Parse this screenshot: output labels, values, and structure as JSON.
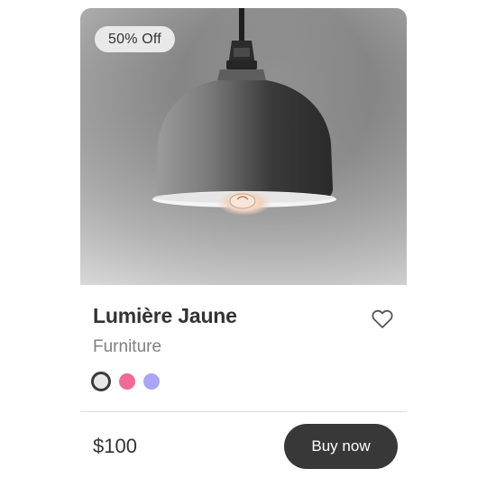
{
  "product": {
    "discount_badge": "50% Off",
    "title": "Lumière Jaune",
    "category": "Furniture",
    "price": "$100",
    "buy_label": "Buy now",
    "image_icon": "pendant-lamp",
    "favorite_icon": "heart-icon",
    "swatches": [
      {
        "color": "#e8e8e8",
        "selected": true
      },
      {
        "color": "#f06a95",
        "selected": false
      },
      {
        "color": "#a9a5f7",
        "selected": false
      }
    ]
  }
}
